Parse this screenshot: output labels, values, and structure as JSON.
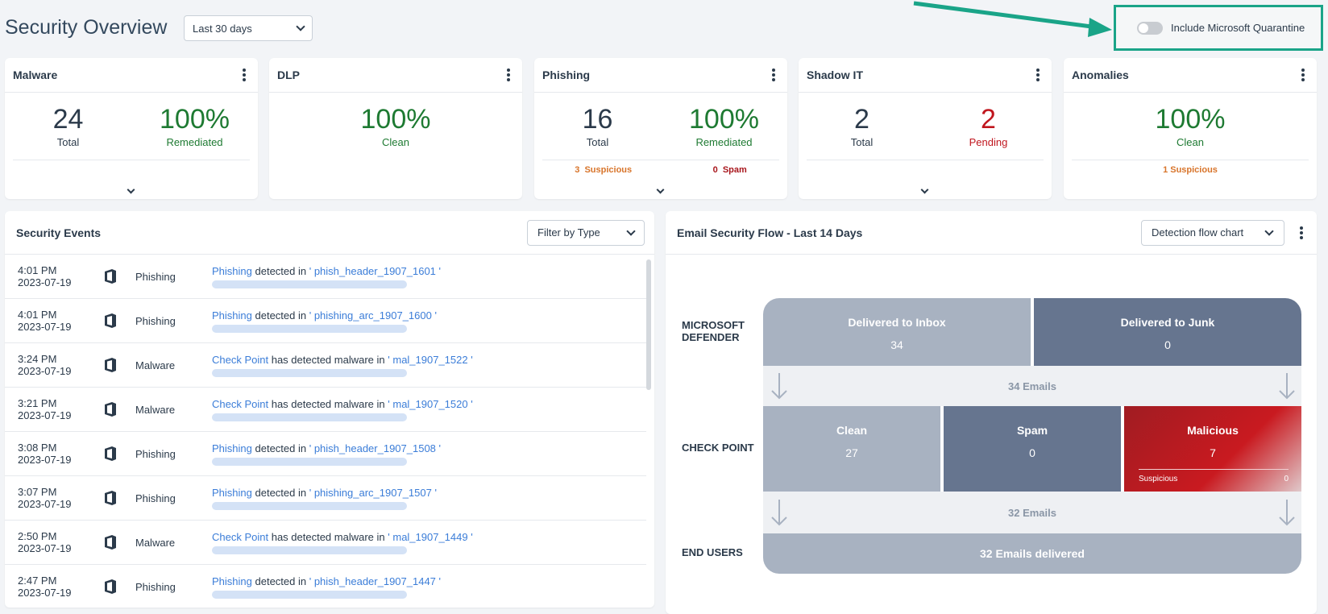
{
  "header": {
    "title": "Security Overview",
    "period": "Last 30 days",
    "toggle_label": "Include Microsoft Quarantine"
  },
  "colors": {
    "accent_teal": "#1aa488",
    "green": "#1e7a32",
    "red": "#c0161e",
    "orange": "#d8742a",
    "link": "#3b7dd8"
  },
  "cards": {
    "malware": {
      "title": "Malware",
      "total": "24",
      "total_label": "Total",
      "pct": "100%",
      "pct_label": "Remediated"
    },
    "dlp": {
      "title": "DLP",
      "pct": "100%",
      "pct_label": "Clean"
    },
    "phishing": {
      "title": "Phishing",
      "total": "16",
      "total_label": "Total",
      "pct": "100%",
      "pct_label": "Remediated",
      "suspicious_count": "3",
      "suspicious_label": "Suspicious",
      "spam_count": "0",
      "spam_label": "Spam"
    },
    "shadow_it": {
      "title": "Shadow IT",
      "total": "2",
      "total_label": "Total",
      "pending": "2",
      "pending_label": "Pending"
    },
    "anomalies": {
      "title": "Anomalies",
      "pct": "100%",
      "pct_label": "Clean",
      "suspicious": "1 Suspicious"
    }
  },
  "events": {
    "title": "Security Events",
    "filter": "Filter by Type",
    "rows": [
      {
        "time": "4:01 PM",
        "date": "2023-07-19",
        "type": "Phishing",
        "actor": "Phishing",
        "verb": "detected in",
        "target": "phish_header_1907_1601"
      },
      {
        "time": "4:01 PM",
        "date": "2023-07-19",
        "type": "Phishing",
        "actor": "Phishing",
        "verb": "detected in",
        "target": "phishing_arc_1907_1600"
      },
      {
        "time": "3:24 PM",
        "date": "2023-07-19",
        "type": "Malware",
        "actor": "Check Point",
        "verb": "has detected malware in",
        "target": "mal_1907_1522"
      },
      {
        "time": "3:21 PM",
        "date": "2023-07-19",
        "type": "Malware",
        "actor": "Check Point",
        "verb": "has detected malware in",
        "target": "mal_1907_1520"
      },
      {
        "time": "3:08 PM",
        "date": "2023-07-19",
        "type": "Phishing",
        "actor": "Phishing",
        "verb": "detected in",
        "target": "phish_header_1907_1508"
      },
      {
        "time": "3:07 PM",
        "date": "2023-07-19",
        "type": "Phishing",
        "actor": "Phishing",
        "verb": "detected in",
        "target": "phishing_arc_1907_1507"
      },
      {
        "time": "2:50 PM",
        "date": "2023-07-19",
        "type": "Malware",
        "actor": "Check Point",
        "verb": "has detected malware in",
        "target": "mal_1907_1449"
      },
      {
        "time": "2:47 PM",
        "date": "2023-07-19",
        "type": "Phishing",
        "actor": "Phishing",
        "verb": "detected in",
        "target": "phish_header_1907_1447"
      }
    ]
  },
  "flow": {
    "title": "Email Security Flow - Last 14 Days",
    "chart_select": "Detection flow chart",
    "labels": {
      "defender": "MICROSOFT DEFENDER",
      "checkpoint": "CHECK POINT",
      "end_users": "END USERS"
    },
    "inbox_label": "Delivered to Inbox",
    "inbox_value": "34",
    "junk_label": "Delivered to Junk",
    "junk_value": "0",
    "band1": "34 Emails",
    "clean_label": "Clean",
    "clean_value": "27",
    "spam_label": "Spam",
    "spam_value": "0",
    "malicious_label": "Malicious",
    "malicious_value": "7",
    "suspicious_label": "Suspicious",
    "suspicious_value": "0",
    "band2": "32 Emails",
    "delivered": "32 Emails delivered"
  }
}
